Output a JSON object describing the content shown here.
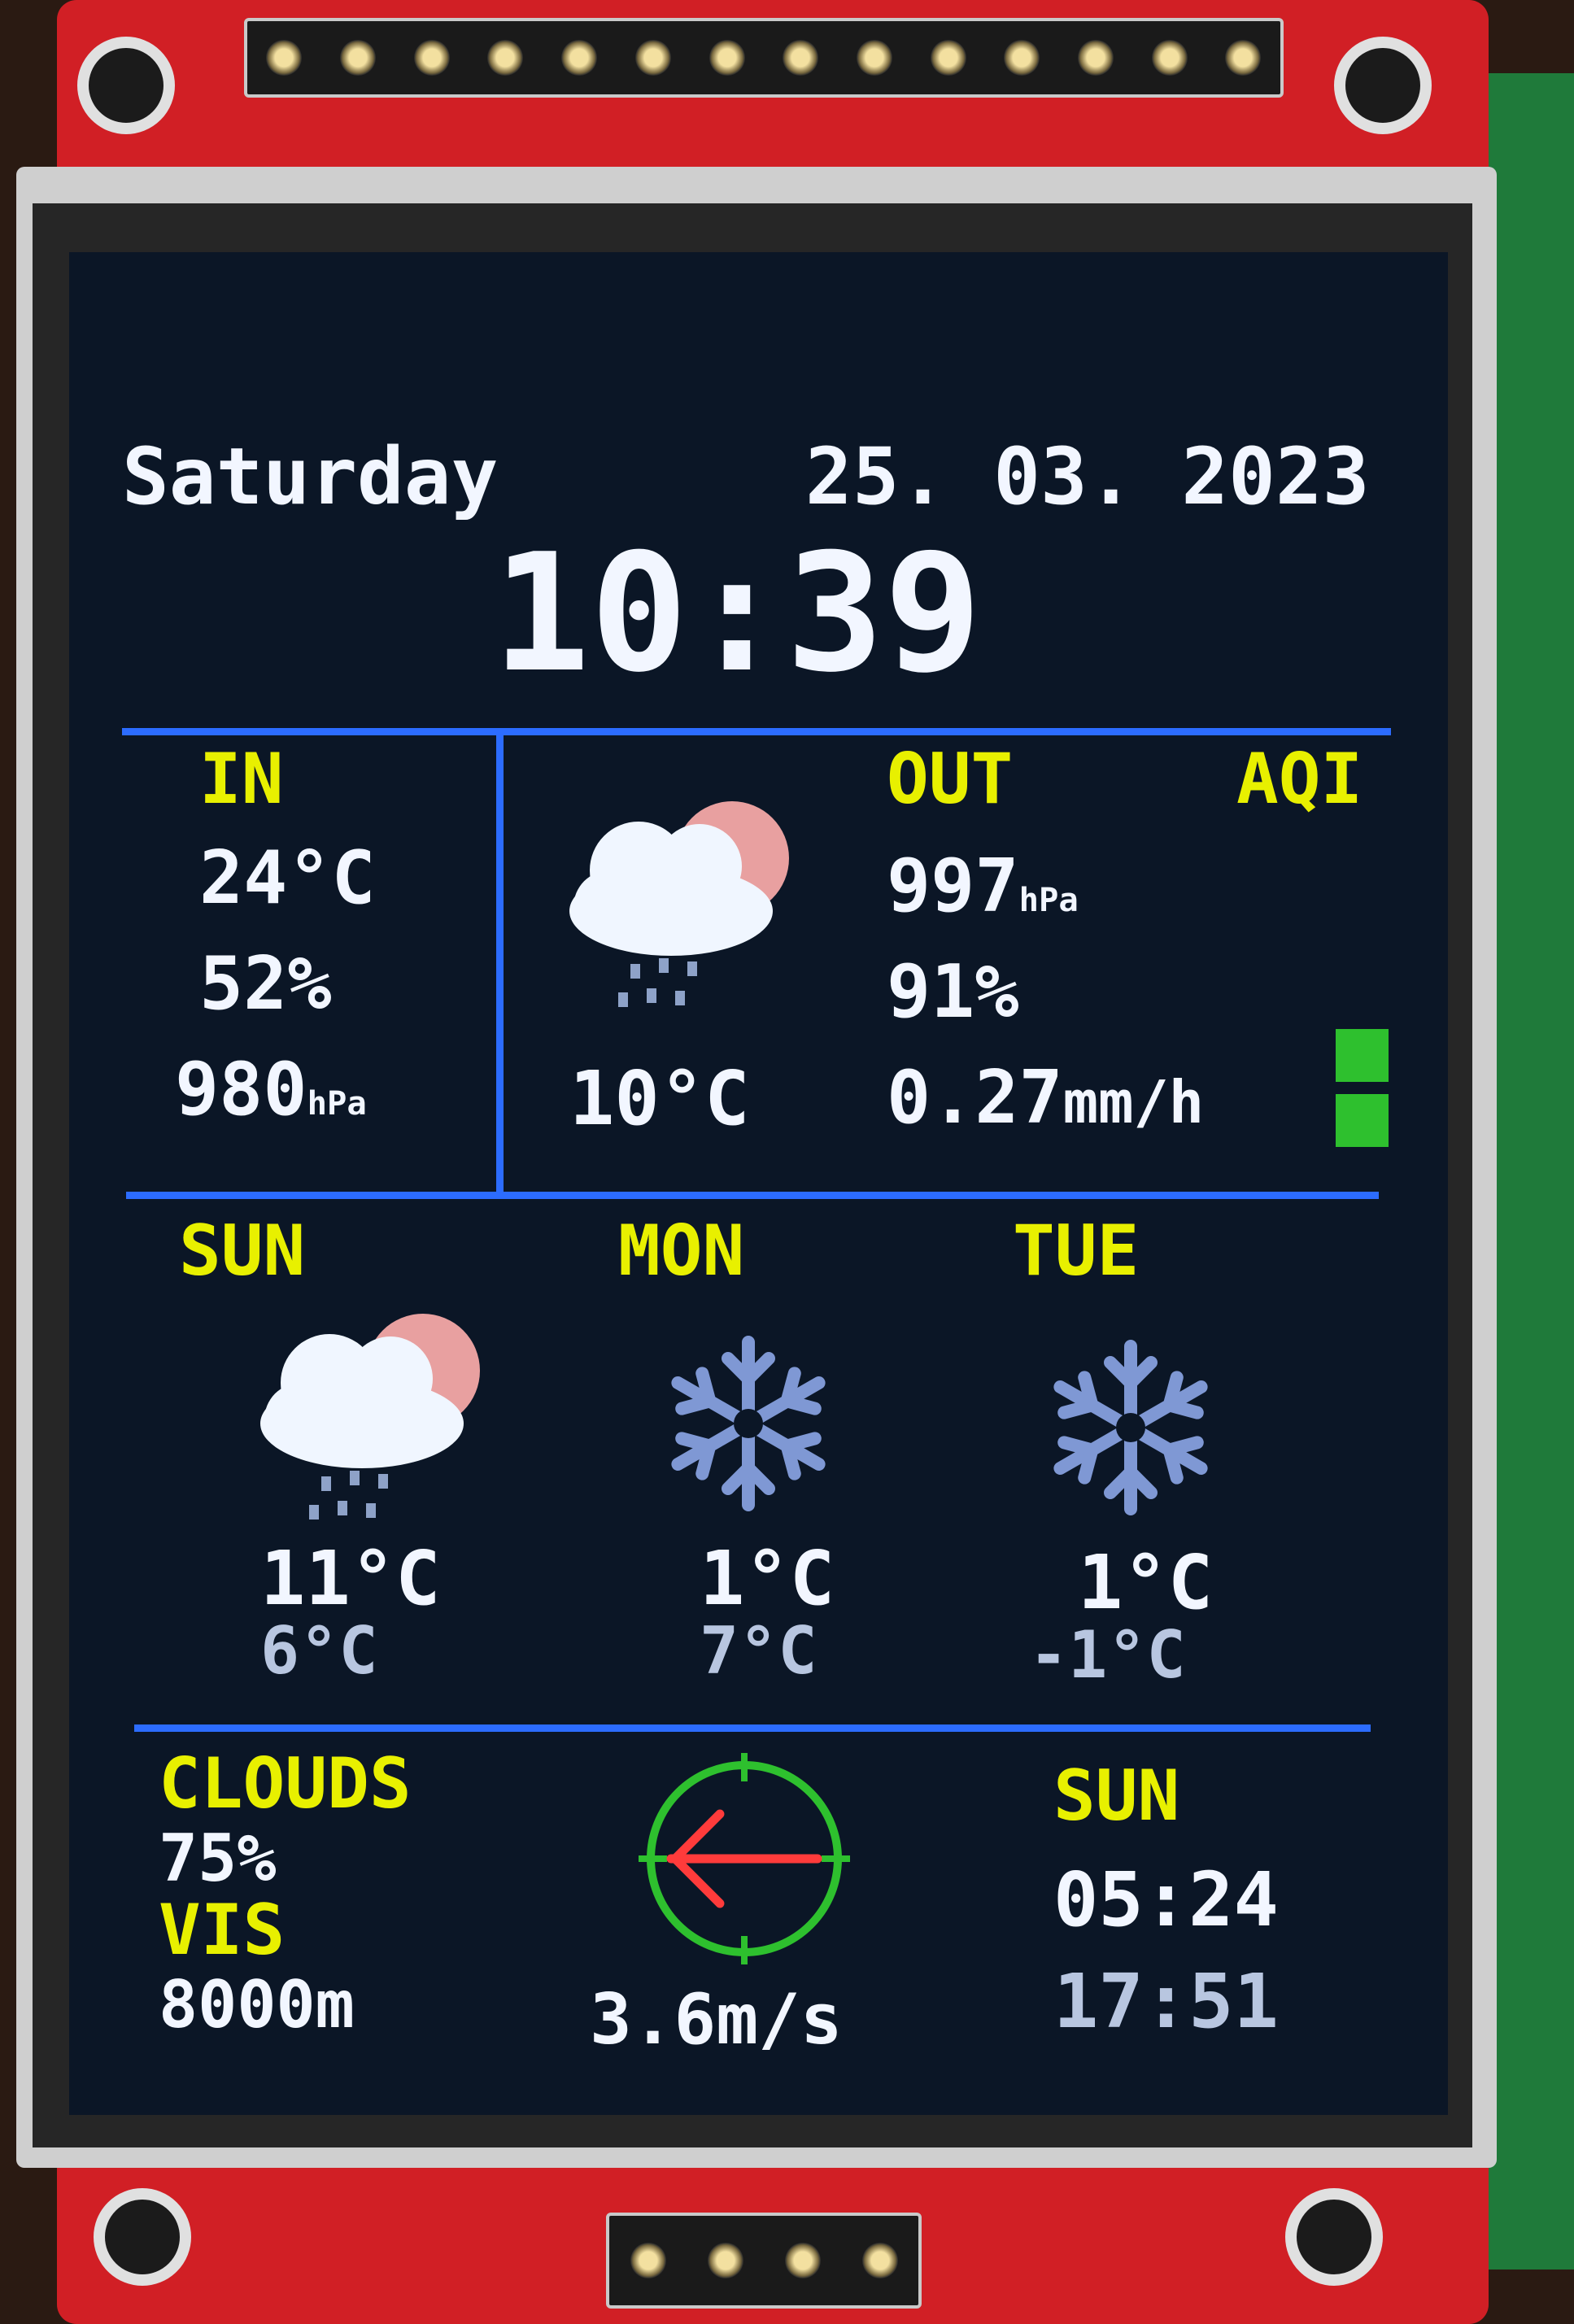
{
  "header": {
    "weekday": "Saturday",
    "date": "25. 03. 2023",
    "time": "10:39"
  },
  "indoor": {
    "label": "IN",
    "temperature": "24°C",
    "humidity": "52%",
    "pressure": "980",
    "pressure_unit": "hPa"
  },
  "outdoor": {
    "label": "OUT",
    "aqi_label": "AQI",
    "icon": "cloud-sun-rain-icon",
    "temperature": "10°C",
    "pressure": "997",
    "pressure_unit": "hPa",
    "humidity": "91%",
    "rain": "0.27",
    "rain_unit": "mm/h",
    "aqi_level_bars": 2,
    "aqi_color": "#2ec02e"
  },
  "forecast": [
    {
      "day": "SUN",
      "icon": "cloud-sun-rain-icon",
      "high": "11°C",
      "low": "6°C"
    },
    {
      "day": "MON",
      "icon": "snowflake-icon",
      "high": "1°C",
      "low": "7°C"
    },
    {
      "day": "TUE",
      "icon": "snowflake-icon",
      "high": "1°C",
      "low": "-1°C"
    }
  ],
  "bottom": {
    "clouds_label": "CLOUDS",
    "clouds_value": "75%",
    "visibility_label": "VIS",
    "visibility_value": "8000m",
    "wind_icon": "wind-direction-compass-icon",
    "wind_speed": "3.6m/s",
    "sun_label": "SUN",
    "sunrise": "05:24",
    "sunset": "17:51"
  },
  "colors": {
    "background": "#0b1626",
    "text": "#f2f6ff",
    "label": "#e8f000",
    "divider": "#2c6cff",
    "compass": "#2ec02e",
    "wind_arrow": "#ff3b3b"
  }
}
